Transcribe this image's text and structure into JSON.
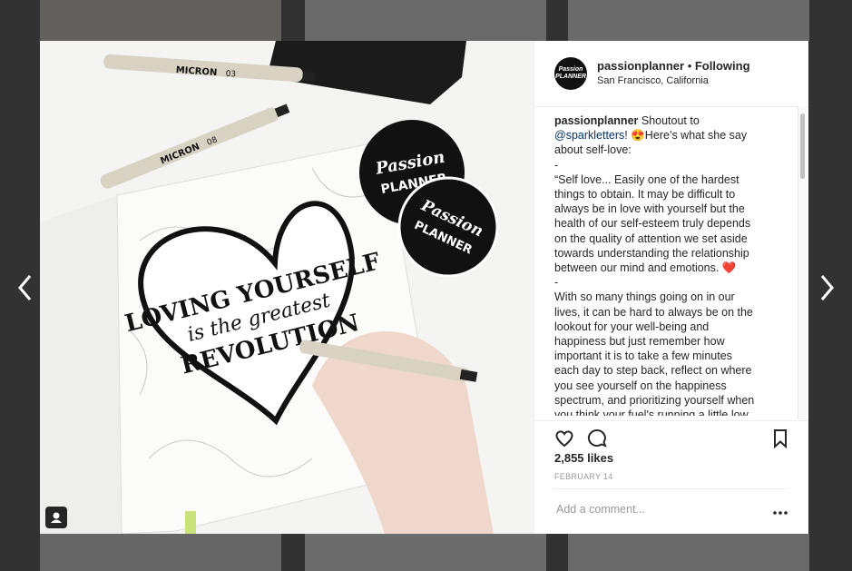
{
  "post": {
    "username": "passionplanner",
    "separator": " • ",
    "follow_status": "Following",
    "location": "San Francisco, California",
    "avatar_text": "Passion PLANNER",
    "likes": "2,855 likes",
    "date": "FEBRUARY 14"
  },
  "caption": {
    "lines": [
      {
        "parts": [
          {
            "t": "passionplanner",
            "k": "u"
          },
          {
            "t": " Shoutout to",
            "k": "p"
          }
        ]
      },
      {
        "parts": [
          {
            "t": "@sparkletters",
            "k": "mention"
          },
          {
            "t": "! 😍Here’s what she say",
            "k": "p"
          }
        ]
      },
      {
        "parts": [
          {
            "t": "about self-love:",
            "k": "p"
          }
        ]
      },
      {
        "parts": [
          {
            "t": "-",
            "k": "p"
          }
        ]
      },
      {
        "parts": [
          {
            "t": "“Self love... Easily one of the hardest",
            "k": "p"
          }
        ]
      },
      {
        "parts": [
          {
            "t": "things to obtain. It may be difficult to",
            "k": "p"
          }
        ]
      },
      {
        "parts": [
          {
            "t": "always be in love with yourself but the",
            "k": "p"
          }
        ]
      },
      {
        "parts": [
          {
            "t": "health of our self-esteem truly depends",
            "k": "p"
          }
        ]
      },
      {
        "parts": [
          {
            "t": "on the quality of attention we set aside",
            "k": "p"
          }
        ]
      },
      {
        "parts": [
          {
            "t": "towards understanding the relationship",
            "k": "p"
          }
        ]
      },
      {
        "parts": [
          {
            "t": "between our mind and emotions. ❤️",
            "k": "p"
          }
        ]
      },
      {
        "parts": [
          {
            "t": "-",
            "k": "p"
          }
        ]
      },
      {
        "parts": [
          {
            "t": "With so many things going on in our",
            "k": "p"
          }
        ]
      },
      {
        "parts": [
          {
            "t": "lives, it can be hard to always be on the",
            "k": "p"
          }
        ]
      },
      {
        "parts": [
          {
            "t": "lookout for your well-being and",
            "k": "p"
          }
        ]
      },
      {
        "parts": [
          {
            "t": "happiness but just remember how",
            "k": "p"
          }
        ]
      },
      {
        "parts": [
          {
            "t": "important it is to take a few minutes",
            "k": "p"
          }
        ]
      },
      {
        "parts": [
          {
            "t": "each day to step back, reflect on where",
            "k": "p"
          }
        ]
      },
      {
        "parts": [
          {
            "t": "you see yourself on the happiness",
            "k": "p"
          }
        ]
      },
      {
        "parts": [
          {
            "t": "spectrum, and prioritizing yourself when",
            "k": "p"
          }
        ]
      },
      {
        "parts": [
          {
            "t": "you think your fuel's running a little low.",
            "k": "p"
          }
        ]
      }
    ]
  },
  "comment": {
    "placeholder": "Add a comment..."
  },
  "image_text": {
    "heart_line1": "LOVING YOURSELF",
    "heart_line2": "is the greatest",
    "heart_line3": "REVOLUTION",
    "sticker_word1": "Passion",
    "sticker_word2": "PLANNER",
    "pen_brand": "MICRON",
    "pen_size_1": "03",
    "pen_size_2": "08"
  },
  "icons": {
    "prev": "chevron-left-icon",
    "next": "chevron-right-icon",
    "like": "heart-outline-icon",
    "comment": "speech-bubble-icon",
    "save": "bookmark-icon",
    "more": "more-dots-icon",
    "user_tags": "user-tag-icon"
  }
}
